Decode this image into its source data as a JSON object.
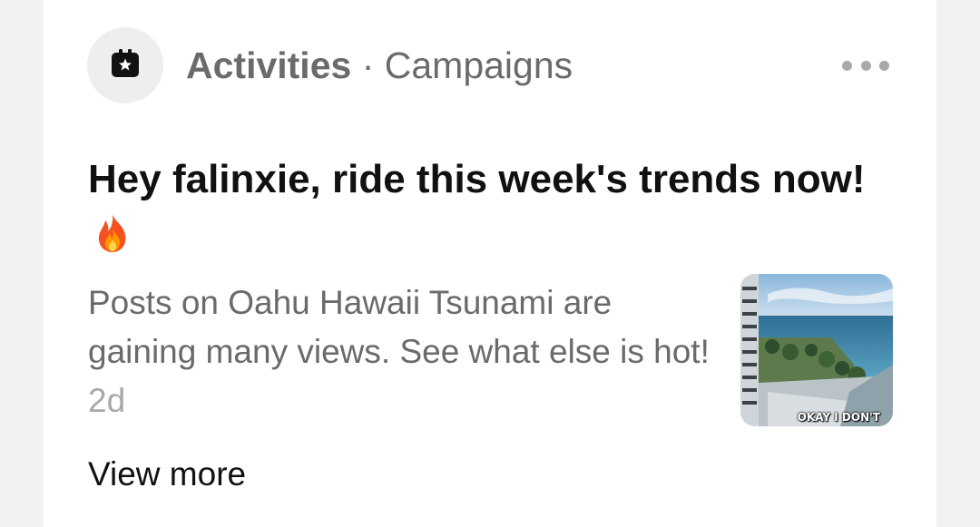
{
  "notification": {
    "icon": "calendar-star-icon",
    "category": "Activities",
    "separator": " · ",
    "subcategory": "Campaigns",
    "more_icon": "more-horizontal-icon",
    "title": "Hey falinxie, ride this week's trends now!",
    "title_emoji": "fire-icon",
    "body": "Posts on Oahu Hawaii Tsunami are gaining many views. See what else is hot!",
    "age": "2d",
    "thumbnail": {
      "description_icon": "ocean-view-thumbnail",
      "caption": "OKAY I DON'T"
    },
    "view_more_label": "View more"
  },
  "colors": {
    "card_bg": "#ffffff",
    "page_bg": "#f1f1f1",
    "header_text": "#6b6b6b",
    "title_text": "#111111",
    "body_text": "#6a6a6a",
    "age_text": "#a8a8a8"
  }
}
